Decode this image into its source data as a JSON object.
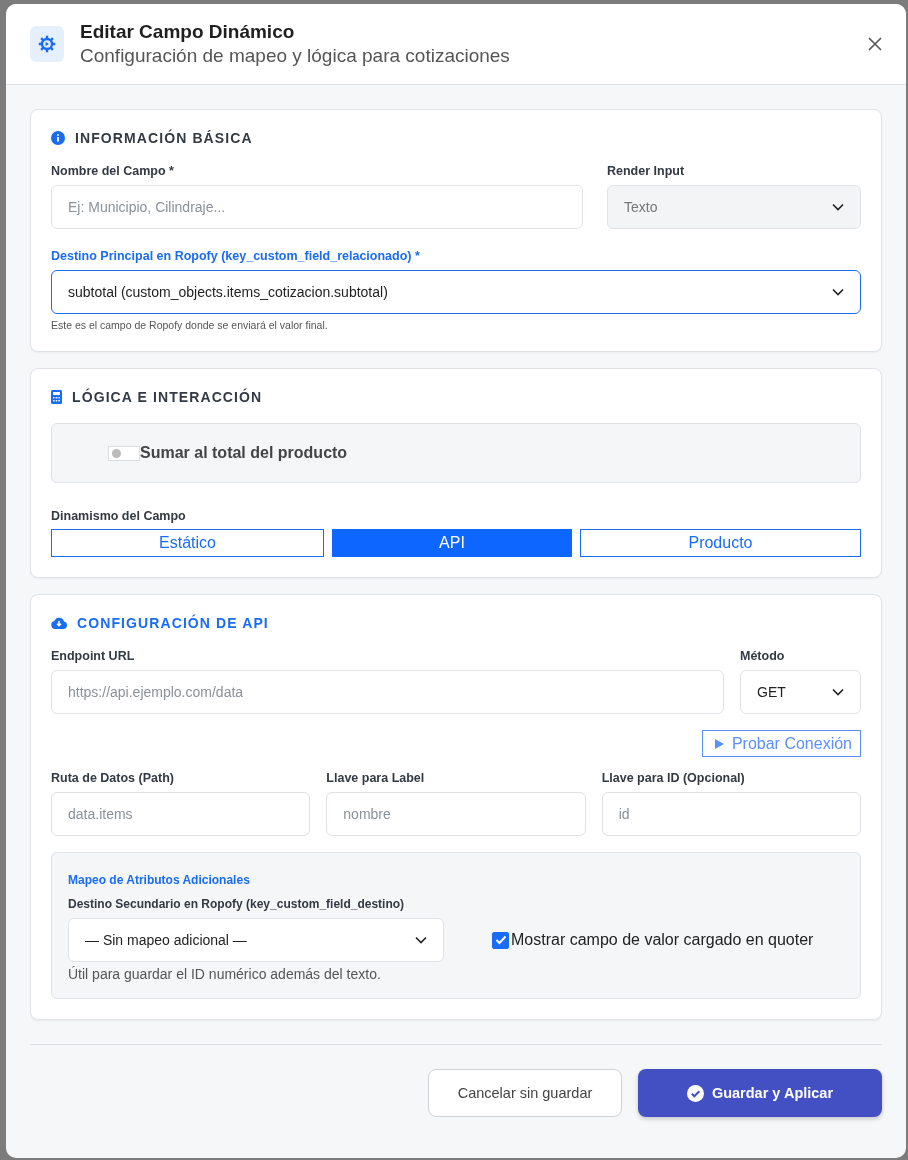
{
  "header": {
    "title": "Editar Campo Dinámico",
    "subtitle": "Configuración de mapeo y lógica para cotizaciones"
  },
  "basic": {
    "kind": "info",
    "title": "INFORMACIÓN BÁSICA",
    "accent": false,
    "name_field": {
      "label": "Nombre del Campo *",
      "placeholder": "Ej: Municipio, Cilindraje..."
    },
    "render_field": {
      "label": "Render Input",
      "value": "Texto",
      "disabled": true
    },
    "destination": {
      "label": "Destino Principal en Ropofy (key_custom_field_relacionado) *",
      "value": "subtotal (custom_objects.items_cotizacion.subtotal)",
      "focused": true,
      "hint": "Este es el campo de Ropofy donde se enviará el valor final."
    }
  },
  "logic": {
    "kind": "calculator",
    "title": "LÓGICA E INTERACCIÓN",
    "accent": false,
    "toggle": {
      "label": "Sumar al total del producto",
      "on": false
    },
    "mode": {
      "label": "Dinamismo del Campo",
      "options": [
        {
          "label": "Estático",
          "selected": false
        },
        {
          "label": "API",
          "selected": true
        },
        {
          "label": "Producto",
          "selected": false
        }
      ]
    }
  },
  "api": {
    "kind": "cloud",
    "title": "CONFIGURACIÓN DE API",
    "accent": true,
    "endpoint": {
      "label": "Endpoint URL",
      "placeholder": "https://api.ejemplo.com/data"
    },
    "method": {
      "label": "Método",
      "value": "GET"
    },
    "test_button": "Probar Conexión",
    "keys": [
      {
        "label": "Ruta de Datos (Path)",
        "placeholder": "data.items"
      },
      {
        "label": "Llave para Label",
        "placeholder": "nombre"
      },
      {
        "label": "Llave para ID (Opcional)",
        "placeholder": "id"
      }
    ],
    "mapping": {
      "title": "Mapeo de Atributos Adicionales",
      "label": "Destino Secundario en Ropofy (key_custom_field_destino)",
      "value": "— Sin mapeo adicional —",
      "hint": "Útil para guardar el ID numérico además del texto.",
      "show_loaded": {
        "label": "Mostrar campo de valor cargado en quoter",
        "checked": true
      }
    }
  },
  "footer": {
    "cancel": "Cancelar sin guardar",
    "save": "Guardar y Aplicar"
  }
}
